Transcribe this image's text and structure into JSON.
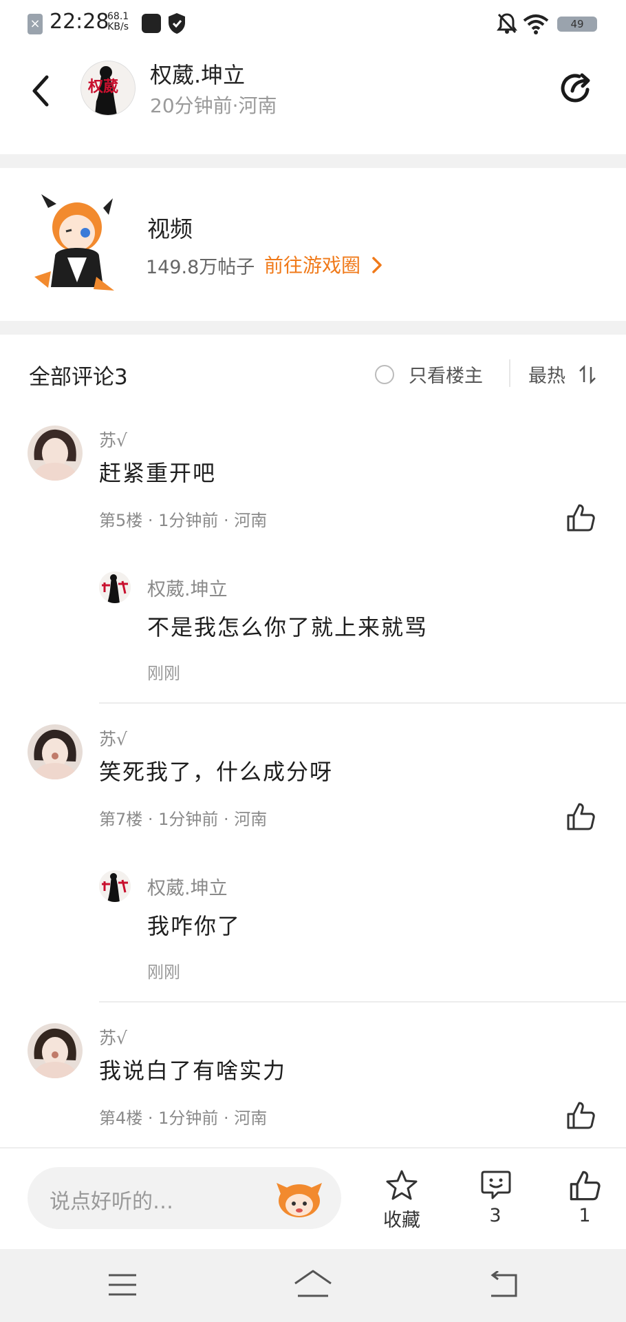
{
  "status_bar": {
    "time": "22:28",
    "speed_value": "68.1",
    "speed_unit": "KB/s",
    "battery": "49"
  },
  "post_header": {
    "author_name": "权葳.坤立",
    "author_meta": "20分钟前·河南",
    "avatar_text": "权葳"
  },
  "circle": {
    "name": "视频",
    "post_count": "149.8万帖子",
    "link_label": "前往游戏圈",
    "link_color": "#f07a1a"
  },
  "comments_header": {
    "title": "全部评论3",
    "only_op_label": "只看楼主",
    "sort_label": "最热"
  },
  "comments": [
    {
      "user": "苏√",
      "text": "赶紧重开吧",
      "meta": "第5楼 · 1分钟前 · 河南",
      "reply": {
        "user": "权葳.坤立",
        "text": "不是我怎么你了就上来就骂",
        "time": "刚刚"
      }
    },
    {
      "user": "苏√",
      "text": "笑死我了，什么成分呀",
      "meta": "第7楼 · 1分钟前 · 河南",
      "reply": {
        "user": "权葳.坤立",
        "text": "我咋你了",
        "time": "刚刚"
      }
    },
    {
      "user": "苏√",
      "text": "我说白了有啥实力",
      "meta": "第4楼 · 1分钟前 · 河南"
    }
  ],
  "bottom_bar": {
    "input_placeholder": "说点好听的…",
    "favorite_label": "收藏",
    "comment_count": "3",
    "like_count": "1"
  },
  "colors": {
    "accent": "#f07a1a",
    "divider": "#f1f1f1",
    "secondary_text": "#8a8a8a"
  }
}
